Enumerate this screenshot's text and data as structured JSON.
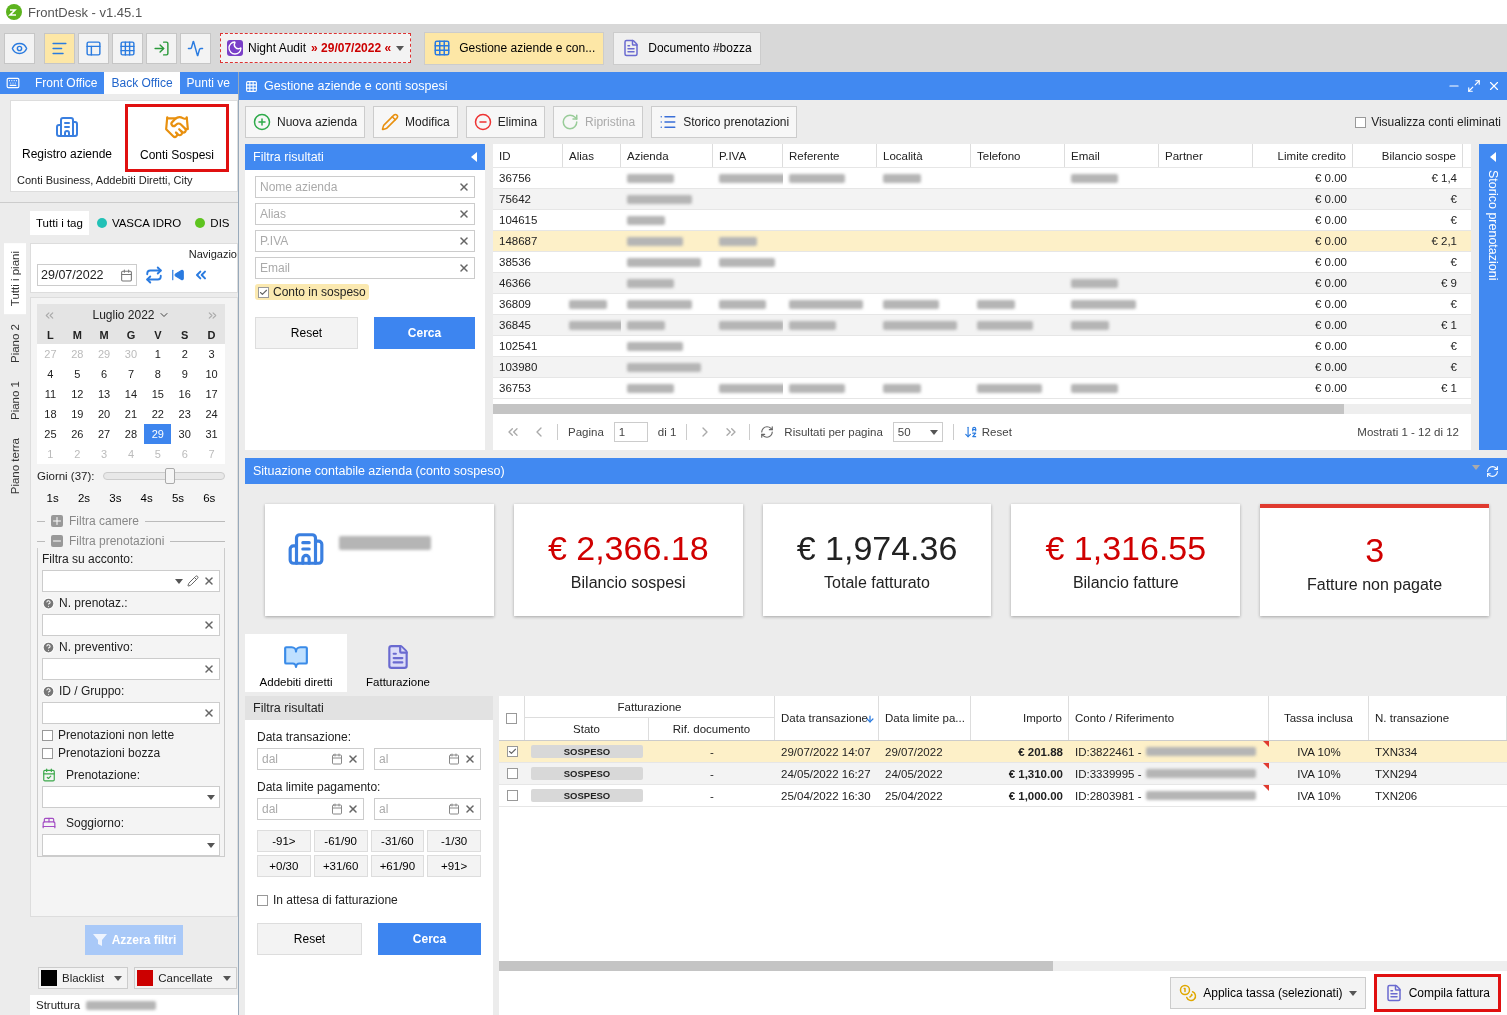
{
  "app": {
    "title": "FrontDesk - v1.45.1"
  },
  "toolbar": {
    "view_buttons": [
      {
        "selected": false
      },
      {
        "selected": true
      },
      {
        "selected": false
      },
      {
        "selected": false
      },
      {
        "selected": false
      },
      {
        "selected": false
      }
    ],
    "night_audit": {
      "label": "Night Audit",
      "date": "» 29/07/2022 «"
    },
    "open_tabs": [
      {
        "label": "Gestione aziende e con...",
        "selected": true
      },
      {
        "label": "Documento #bozza",
        "selected": false
      }
    ]
  },
  "module_tabs": [
    {
      "label": "Front Office",
      "selected": false
    },
    {
      "label": "Back Office",
      "selected": true
    },
    {
      "label": "Punti ve",
      "selected": false
    }
  ],
  "ribbon": {
    "items": [
      {
        "label": "Registro aziende",
        "highlighted": false
      },
      {
        "label": "Conti Sospesi",
        "highlighted": true
      }
    ],
    "caption": "Conti Business, Addebiti Diretti, City"
  },
  "floor_tabs": [
    {
      "label": "Tutti i piani",
      "selected": true
    },
    {
      "label": "Piano 2",
      "selected": false
    },
    {
      "label": "Piano 1",
      "selected": false
    },
    {
      "label": "Piano terra",
      "selected": false
    }
  ],
  "tag_tabs": [
    {
      "label": "Tutti i tag",
      "selected": true
    },
    {
      "label": "VASCA IDRO",
      "selected": false,
      "color": "#22c1b6"
    },
    {
      "label": "DIS",
      "selected": false,
      "color": "#5ec41f"
    }
  ],
  "navigation": {
    "label": "Navigazio",
    "date": "29/07/2022"
  },
  "calendar": {
    "month": "Luglio 2022",
    "weekdays": [
      "L",
      "M",
      "M",
      "G",
      "V",
      "S",
      "D"
    ],
    "weeks": [
      [
        {
          "d": "27",
          "muted": true,
          "selected": false
        },
        {
          "d": "28",
          "muted": true,
          "selected": false
        },
        {
          "d": "29",
          "muted": true,
          "selected": false
        },
        {
          "d": "30",
          "muted": true,
          "selected": false
        },
        {
          "d": "1",
          "muted": false,
          "selected": false
        },
        {
          "d": "2",
          "muted": false,
          "selected": false
        },
        {
          "d": "3",
          "muted": false,
          "selected": false
        }
      ],
      [
        {
          "d": "4",
          "muted": false,
          "selected": false
        },
        {
          "d": "5",
          "muted": false,
          "selected": false
        },
        {
          "d": "6",
          "muted": false,
          "selected": false
        },
        {
          "d": "7",
          "muted": false,
          "selected": false
        },
        {
          "d": "8",
          "muted": false,
          "selected": false
        },
        {
          "d": "9",
          "muted": false,
          "selected": false
        },
        {
          "d": "10",
          "muted": false,
          "selected": false
        }
      ],
      [
        {
          "d": "11",
          "muted": false,
          "selected": false
        },
        {
          "d": "12",
          "muted": false,
          "selected": false
        },
        {
          "d": "13",
          "muted": false,
          "selected": false
        },
        {
          "d": "14",
          "muted": false,
          "selected": false
        },
        {
          "d": "15",
          "muted": false,
          "selected": false
        },
        {
          "d": "16",
          "muted": false,
          "selected": false
        },
        {
          "d": "17",
          "muted": false,
          "selected": false
        }
      ],
      [
        {
          "d": "18",
          "muted": false,
          "selected": false
        },
        {
          "d": "19",
          "muted": false,
          "selected": false
        },
        {
          "d": "20",
          "muted": false,
          "selected": false
        },
        {
          "d": "21",
          "muted": false,
          "selected": false
        },
        {
          "d": "22",
          "muted": false,
          "selected": false
        },
        {
          "d": "23",
          "muted": false,
          "selected": false
        },
        {
          "d": "24",
          "muted": false,
          "selected": false
        }
      ],
      [
        {
          "d": "25",
          "muted": false,
          "selected": false
        },
        {
          "d": "26",
          "muted": false,
          "selected": false
        },
        {
          "d": "27",
          "muted": false,
          "selected": false
        },
        {
          "d": "28",
          "muted": false,
          "selected": false
        },
        {
          "d": "29",
          "muted": false,
          "selected": true
        },
        {
          "d": "30",
          "muted": false,
          "selected": false
        },
        {
          "d": "31",
          "muted": false,
          "selected": false
        }
      ],
      [
        {
          "d": "1",
          "muted": true,
          "selected": false
        },
        {
          "d": "2",
          "muted": true,
          "selected": false
        },
        {
          "d": "3",
          "muted": true,
          "selected": false
        },
        {
          "d": "4",
          "muted": true,
          "selected": false
        },
        {
          "d": "5",
          "muted": true,
          "selected": false
        },
        {
          "d": "6",
          "muted": true,
          "selected": false
        },
        {
          "d": "7",
          "muted": true,
          "selected": false
        }
      ]
    ]
  },
  "days_slider": {
    "label": "Giorni (37):",
    "level": 0.55
  },
  "week_buttons": [
    "1s",
    "2s",
    "3s",
    "4s",
    "5s",
    "6s"
  ],
  "room_filter": {
    "label": "Filtra camere",
    "expanded": false
  },
  "booking_filter": {
    "label": "Filtra prenotazioni",
    "expanded": true,
    "items": [
      {
        "kind": "combo",
        "label": "Filtra su acconto:"
      },
      {
        "kind": "text",
        "label": "N. prenotaz.:"
      },
      {
        "kind": "text",
        "label": "N. preventivo:"
      },
      {
        "kind": "text",
        "label": "ID / Gruppo:"
      },
      {
        "kind": "check",
        "label": "Prenotazioni non lette",
        "checked": false
      },
      {
        "kind": "check",
        "label": "Prenotazioni bozza",
        "checked": false
      },
      {
        "kind": "select",
        "label": "Prenotazione:"
      },
      {
        "kind": "select",
        "label": "Soggiorno:"
      }
    ]
  },
  "reset_filters": {
    "label": "Azzera filtri",
    "disabled": true
  },
  "legend": [
    {
      "label": "Blacklist",
      "color": "#000000"
    },
    {
      "label": "Cancellate",
      "color": "#cc0000"
    }
  ],
  "status_bar": {
    "label": "Struttura"
  },
  "window": {
    "title": "Gestione aziende e conti sospesi"
  },
  "actions": [
    {
      "label": "Nuova azienda",
      "disabled": false
    },
    {
      "label": "Modifica",
      "disabled": false
    },
    {
      "label": "Elimina",
      "disabled": false
    },
    {
      "label": "Ripristina",
      "disabled": true
    },
    {
      "label": "Storico prenotazioni",
      "disabled": false
    }
  ],
  "show_deleted": {
    "label": "Visualizza conti eliminati",
    "checked": false
  },
  "company_filter": {
    "title": "Filtra risultati",
    "fields": [
      {
        "placeholder": "Nome azienda"
      },
      {
        "placeholder": "Alias"
      },
      {
        "placeholder": "P.IVA"
      },
      {
        "placeholder": "Email"
      }
    ],
    "suspended": {
      "label": "Conto in sospeso",
      "checked": true
    },
    "buttons": [
      "Reset",
      "Cerca"
    ]
  },
  "companies": {
    "columns": [
      "ID",
      "Alias",
      "Azienda",
      "P.IVA",
      "Referente",
      "Località",
      "Telefono",
      "Email",
      "Partner",
      "Limite credito",
      "Bilancio sospe"
    ],
    "rows": [
      {
        "selected": false,
        "cells": [
          "36756",
          null,
          {
            "blur": true
          },
          {
            "blur": true
          },
          {
            "blur": true
          },
          {
            "blur": true
          },
          null,
          {
            "blur": true
          },
          null,
          "€ 0.00",
          "€ 1,4"
        ]
      },
      {
        "selected": false,
        "cells": [
          "75642",
          null,
          {
            "blur": true
          },
          null,
          null,
          null,
          null,
          null,
          null,
          "€ 0.00",
          "€"
        ]
      },
      {
        "selected": false,
        "cells": [
          "104615",
          null,
          {
            "blur": true
          },
          null,
          null,
          null,
          null,
          null,
          null,
          "€ 0.00",
          "€"
        ]
      },
      {
        "selected": true,
        "cells": [
          "148687",
          null,
          {
            "blur": true
          },
          {
            "blur": true
          },
          null,
          null,
          null,
          null,
          null,
          "€ 0.00",
          "€ 2,1"
        ]
      },
      {
        "selected": false,
        "cells": [
          "38536",
          null,
          {
            "blur": true
          },
          {
            "blur": true
          },
          null,
          null,
          null,
          null,
          null,
          "€ 0.00",
          "€"
        ]
      },
      {
        "selected": false,
        "cells": [
          "46366",
          null,
          {
            "blur": true
          },
          null,
          null,
          null,
          null,
          {
            "blur": true
          },
          null,
          "€ 0.00",
          "€ 9"
        ]
      },
      {
        "selected": false,
        "cells": [
          "36809",
          {
            "blur": true
          },
          {
            "blur": true
          },
          {
            "blur": true
          },
          {
            "blur": true
          },
          {
            "blur": true
          },
          {
            "blur": true
          },
          {
            "blur": true
          },
          null,
          "€ 0.00",
          "€"
        ]
      },
      {
        "selected": false,
        "cells": [
          "36845",
          {
            "blur": true
          },
          {
            "blur": true
          },
          {
            "blur": true
          },
          {
            "blur": true
          },
          {
            "blur": true
          },
          {
            "blur": true
          },
          {
            "blur": true
          },
          null,
          "€ 0.00",
          "€ 1"
        ]
      },
      {
        "selected": false,
        "cells": [
          "102541",
          null,
          {
            "blur": true
          },
          null,
          null,
          null,
          null,
          null,
          null,
          "€ 0.00",
          "€"
        ]
      },
      {
        "selected": false,
        "cells": [
          "103980",
          null,
          {
            "blur": true
          },
          null,
          null,
          null,
          null,
          null,
          null,
          "€ 0.00",
          "€"
        ]
      },
      {
        "selected": false,
        "cells": [
          "36753",
          null,
          {
            "blur": true
          },
          {
            "blur": true
          },
          {
            "blur": true
          },
          {
            "blur": true
          },
          {
            "blur": true
          },
          {
            "blur": true
          },
          null,
          "€ 0.00",
          "€ 1"
        ]
      }
    ]
  },
  "pager": {
    "page_label": "Pagina",
    "page": "1",
    "of": "di 1",
    "per_page_label": "Risultati per pagina",
    "per_page": "50",
    "reset": "Reset",
    "summary": "Mostrati 1 - 12 di 12"
  },
  "side_panel": {
    "label": "Storico prenotazioni"
  },
  "summary": {
    "title": "Situazione contabile azienda (conto sospeso)",
    "cards": [
      {
        "kind": "company",
        "name_blurred": true
      },
      {
        "kind": "stat",
        "value": "€ 2,366.18",
        "label": "Bilancio sospesi",
        "color": "#d00000",
        "flagged": false
      },
      {
        "kind": "stat",
        "value": "€ 1,974.36",
        "label": "Totale fatturato",
        "color": "#222222",
        "flagged": false
      },
      {
        "kind": "stat",
        "value": "€ 1,316.55",
        "label": "Bilancio fatture",
        "color": "#d00000",
        "flagged": false
      },
      {
        "kind": "stat",
        "value": "3",
        "label": "Fatture non pagate",
        "color": "#d00000",
        "flagged": true
      }
    ]
  },
  "detail_tabs": [
    {
      "label": "Addebiti diretti",
      "selected": true
    },
    {
      "label": "Fatturazione",
      "selected": false
    }
  ],
  "transaction_filter": {
    "title": "Filtra risultati",
    "ranges": [
      {
        "label": "Data transazione:",
        "fields": [
          {
            "placeholder": "dal"
          },
          {
            "placeholder": "al"
          }
        ]
      },
      {
        "label": "Data limite pagamento:",
        "fields": [
          {
            "placeholder": "dal"
          },
          {
            "placeholder": "al"
          }
        ]
      }
    ],
    "presets": [
      "-91>",
      "-61/90",
      "-31/60",
      "-1/30",
      "+0/30",
      "+31/60",
      "+61/90",
      "+91>"
    ],
    "pending": {
      "label": "In attesa di fatturazione",
      "checked": false
    },
    "buttons": [
      "Reset",
      "Cerca"
    ]
  },
  "transactions": {
    "all_checked": false,
    "group": {
      "label": "Fatturazione",
      "columns": [
        "Stato",
        "Rif. documento"
      ]
    },
    "columns": [
      {
        "label": "Data transazione",
        "sorted": true
      },
      {
        "label": "Data limite pa...",
        "sorted": false
      },
      {
        "label": "Importo",
        "sorted": false
      },
      {
        "label": "Conto / Riferimento",
        "sorted": false
      },
      {
        "label": "Tassa inclusa",
        "sorted": false
      },
      {
        "label": "N. transazione",
        "sorted": false
      }
    ],
    "rows": [
      {
        "checked": true,
        "selected": true,
        "status": "SOSPESO",
        "document": "-",
        "date": "29/07/2022 14:07",
        "due": "29/07/2022",
        "amount": "€ 201.88",
        "account": "ID:3822461 -",
        "account_blurred": true,
        "tax": "IVA 10%",
        "number": "TXN334"
      },
      {
        "checked": false,
        "selected": false,
        "status": "SOSPESO",
        "document": "-",
        "date": "24/05/2022 16:27",
        "due": "24/05/2022",
        "amount": "€ 1,310.00",
        "account": "ID:3339995 -",
        "account_blurred": true,
        "tax": "IVA 10%",
        "number": "TXN294"
      },
      {
        "checked": false,
        "selected": false,
        "status": "SOSPESO",
        "document": "-",
        "date": "25/04/2022 16:30",
        "due": "25/04/2022",
        "amount": "€ 1,000.00",
        "account": "ID:2803981 -",
        "account_blurred": true,
        "tax": "IVA 10%",
        "number": "TXN206"
      }
    ]
  },
  "footer_actions": [
    {
      "label": "Applica tassa (selezionati)",
      "dropdown": true,
      "highlighted": false
    },
    {
      "label": "Compila fattura",
      "dropdown": false,
      "highlighted": true
    }
  ]
}
